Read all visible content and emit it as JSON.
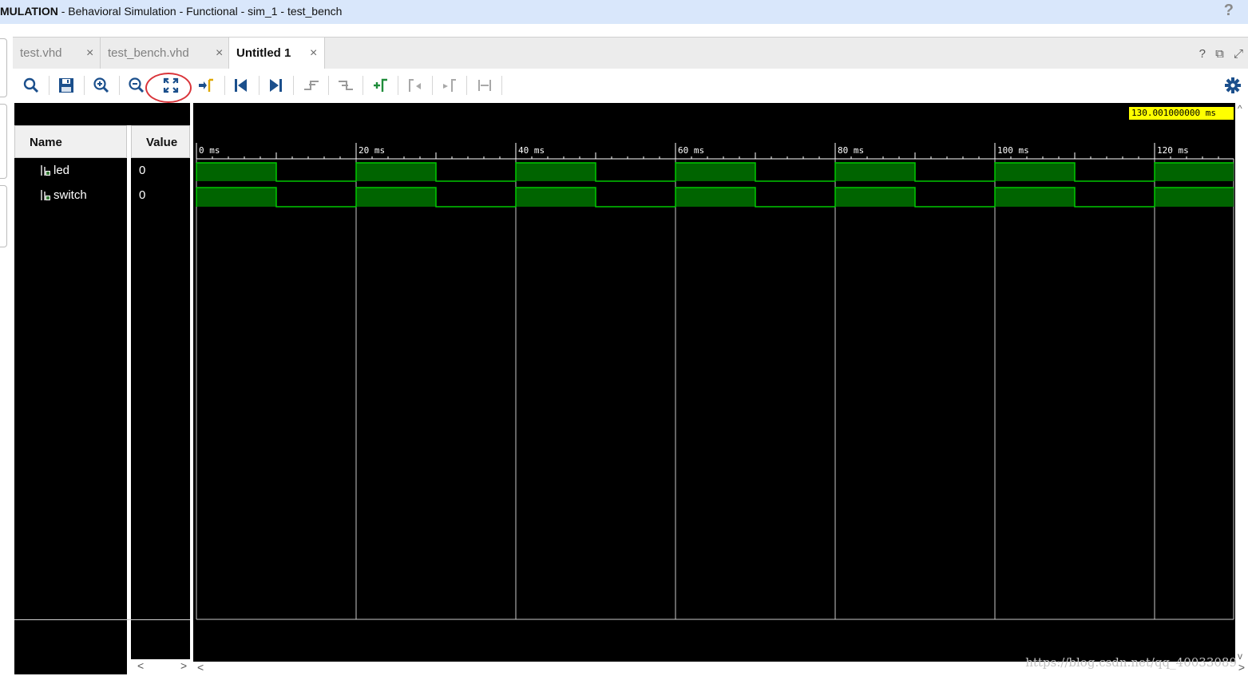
{
  "window": {
    "title_bold": "MULATION",
    "title_rest": " - Behavioral Simulation - Functional - sim_1 - test_bench",
    "help_label": "?"
  },
  "tabs": [
    {
      "label": "test.vhd",
      "close": "×",
      "active": false
    },
    {
      "label": "test_bench.vhd",
      "close": "×",
      "active": false
    },
    {
      "label": "Untitled 1",
      "close": "×",
      "active": true
    }
  ],
  "view_controls": {
    "help": "?",
    "restore": "⧉",
    "float": "⤢"
  },
  "toolbar": {
    "icons": [
      "search-icon",
      "save-icon",
      "zoom-in-icon",
      "zoom-out-icon",
      "zoom-fit-icon",
      "go-to-cursor-icon",
      "go-to-time-zero-icon",
      "go-to-last-time-icon",
      "previous-transition-icon",
      "next-transition-icon",
      "add-marker-icon",
      "previous-marker-icon",
      "next-marker-icon",
      "swap-cursors-icon",
      "settings-icon"
    ],
    "highlighted": "zoom-fit-icon",
    "highlight_color": "#d9343a"
  },
  "objects_panel": {
    "name_header": "Name",
    "value_header": "Value",
    "signals": [
      {
        "name": "led",
        "value": "0"
      },
      {
        "name": "switch",
        "value": "0"
      }
    ],
    "scroll_left": "<",
    "scroll_right": ">"
  },
  "waveform": {
    "cursor_time": "130.001000000 ms",
    "time_range_ms": [
      0,
      130.001
    ],
    "ruler_labels": [
      "0 ms",
      "20 ms",
      "40 ms",
      "60 ms",
      "80 ms",
      "100 ms",
      "120 ms"
    ],
    "major_tick_step_ms": 20,
    "minor_tick_step_ms": 2,
    "signal_period_ms": 20,
    "high_duration_ms": 10,
    "wave_color": "#00c800",
    "wave_fill": "#006400",
    "background": "#000000"
  },
  "watermark": "https://blog.csdn.net/qq_40033089"
}
